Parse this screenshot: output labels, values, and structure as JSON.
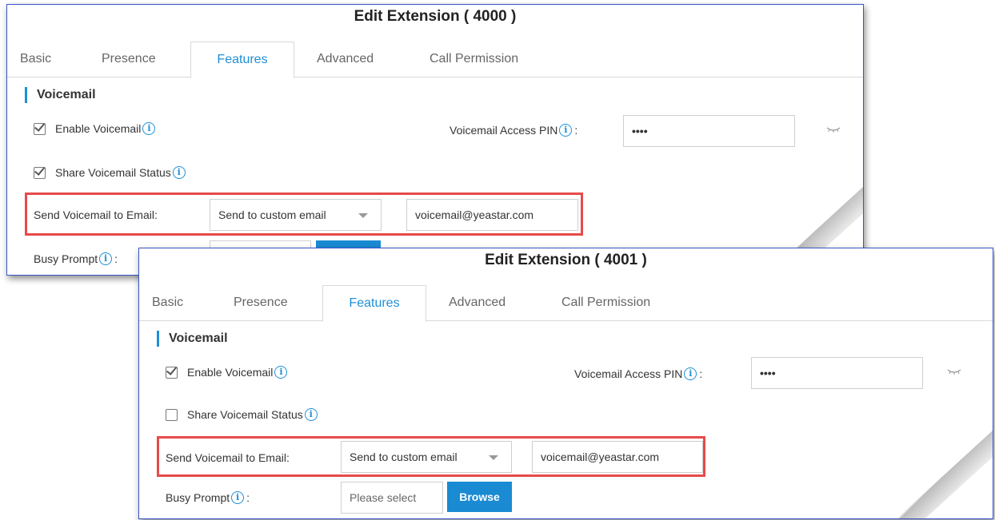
{
  "panel1": {
    "title": "Edit Extension ( 4000 )",
    "tabs": [
      "Basic",
      "Presence",
      "Features",
      "Advanced",
      "Call Permission"
    ],
    "active_tab": "Features",
    "section": "Voicemail",
    "enable_voicemail": {
      "label": "Enable Voicemail",
      "checked": true
    },
    "share_status": {
      "label": "Share Voicemail Status",
      "checked": true
    },
    "pin_label": "Voicemail Access PIN",
    "pin_colon": ":",
    "pin_value": "••••",
    "send_label": "Send Voicemail to Email:",
    "send_select": "Send to custom email",
    "email_value": "voicemail@yeastar.com",
    "busy_label": "Busy Prompt",
    "busy_colon": ":"
  },
  "panel2": {
    "title": "Edit Extension ( 4001 )",
    "tabs": [
      "Basic",
      "Presence",
      "Features",
      "Advanced",
      "Call Permission"
    ],
    "active_tab": "Features",
    "section": "Voicemail",
    "enable_voicemail": {
      "label": "Enable Voicemail",
      "checked": true
    },
    "share_status": {
      "label": "Share Voicemail Status",
      "checked": false
    },
    "pin_label": "Voicemail Access PIN",
    "pin_colon": ":",
    "pin_value": "••••",
    "send_label": "Send Voicemail to Email:",
    "send_select": "Send to custom email",
    "email_value": "voicemail@yeastar.com",
    "busy_label": "Busy Prompt",
    "busy_colon": ":",
    "busy_placeholder": "Please select",
    "browse_label": "Browse"
  },
  "icons": {
    "info": "info-icon",
    "eye": "eye-closed-icon",
    "check": "checkbox-icon",
    "dropdown": "chevron-down-icon"
  },
  "colors": {
    "accent": "#1e8fd6",
    "highlight": "#e74a4a",
    "panel_border": "#3a56c9"
  }
}
